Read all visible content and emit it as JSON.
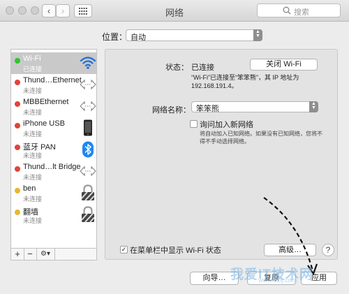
{
  "window": {
    "title": "网络"
  },
  "search": {
    "placeholder": "搜索"
  },
  "location": {
    "label": "位置：",
    "value": "自动"
  },
  "sidebar": {
    "items": [
      {
        "name": "Wi-Fi",
        "status": "已连接",
        "dot_color": "#2ec42e",
        "icon": "wifi-icon"
      },
      {
        "name": "Thund…Ethernet",
        "status": "未连接",
        "dot_color": "#e0443a",
        "icon": "ethernet-arrows-icon"
      },
      {
        "name": "MBBEthernet",
        "status": "未连接",
        "dot_color": "#e0443a",
        "icon": "ethernet-arrows-icon"
      },
      {
        "name": "iPhone USB",
        "status": "未连接",
        "dot_color": "#e0443a",
        "icon": "iphone-icon"
      },
      {
        "name": "蓝牙 PAN",
        "status": "未连接",
        "dot_color": "#e0443a",
        "icon": "bluetooth-icon"
      },
      {
        "name": "Thund…lt Bridge",
        "status": "未连接",
        "dot_color": "#e0443a",
        "icon": "ethernet-arrows-icon"
      },
      {
        "name": "ben",
        "status": "未连接",
        "dot_color": "#e8b730",
        "icon": "lock-icon"
      },
      {
        "name": "翻墙",
        "status": "未连接",
        "dot_color": "#e8b730",
        "icon": "lock-icon"
      }
    ],
    "add_label": "+",
    "remove_label": "−",
    "gear_label": "⚙▾"
  },
  "detail": {
    "status_label": "状态：",
    "status_value": "已连接",
    "wifi_off_button": "关闭 Wi-Fi",
    "status_desc_line1": "“Wi-Fi”已连接至“笨笨熊”，其 IP 地址为",
    "status_desc_line2": "192.168.191.4。",
    "network_name_label": "网络名称：",
    "network_name_value": "笨笨熊",
    "ask_join_label": "询问加入新网络",
    "ask_join_checked": false,
    "ask_join_desc_line1": "将自动加入已知网络。如果没有已知网络，您将不",
    "ask_join_desc_line2": "得不手动选择网络。",
    "show_menu_label": "在菜单栏中显示 Wi-Fi 状态",
    "show_menu_checked": true,
    "check_mark": "✓",
    "advanced_button": "高级…",
    "help_label": "?"
  },
  "footer": {
    "assistant_button": "向导…",
    "revert_button": "复原",
    "apply_button": "应用"
  },
  "watermark": {
    "main": "我爱IT技术网",
    "sub": "www.52ij.com"
  },
  "colors": {
    "selection": "#c9c9c9",
    "wifi_blue": "#1f6fd6",
    "bluetooth_blue": "#1e88f0"
  }
}
